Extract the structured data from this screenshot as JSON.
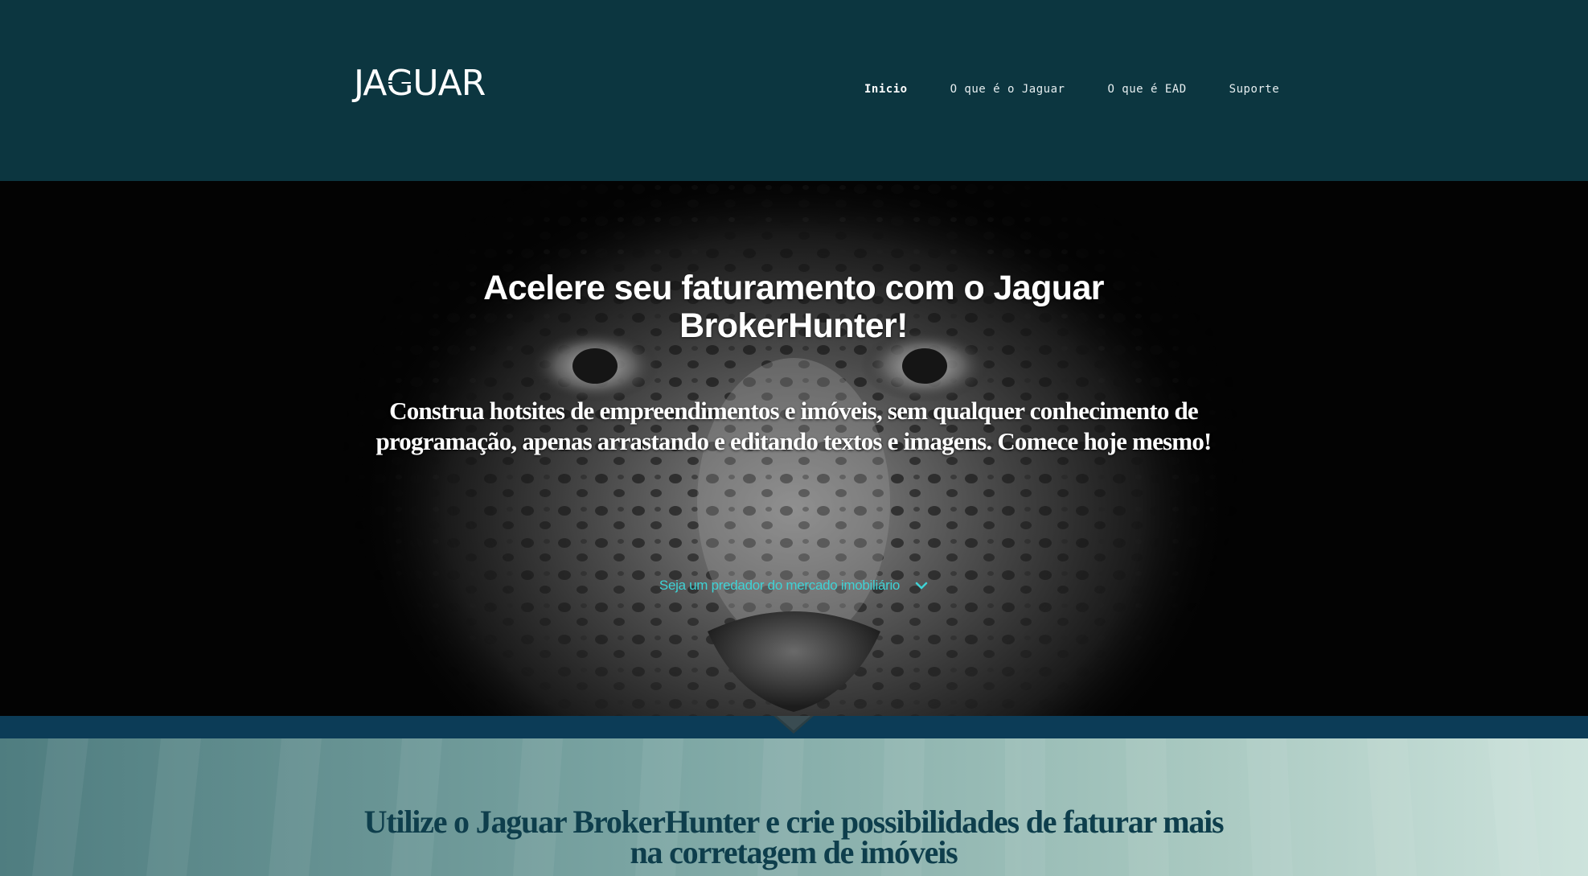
{
  "header": {
    "logo_text_left": "JA",
    "logo_text_g": "G",
    "logo_text_right": "UAR",
    "nav": [
      {
        "label": "Inicio",
        "active": true
      },
      {
        "label": "O que é o Jaguar",
        "active": false
      },
      {
        "label": "O que é EAD",
        "active": false
      },
      {
        "label": "Suporte",
        "active": false
      }
    ]
  },
  "hero": {
    "title_line1": "Acelere seu faturamento com o Jaguar",
    "title_line2": "BrokerHunter!",
    "subtitle": "Construa hotsites de empreendimentos e imóveis, sem qualquer conhecimento de programação, apenas arrastando e editando textos e imagens. Comece hoje mesmo!",
    "cta_label": "Seja um predador do mercado imobiliário",
    "cta_icon": "chevron-down-icon",
    "background_image": "jaguar-face-photo"
  },
  "section2": {
    "title": "Utilize o Jaguar BrokerHunter e crie possibilidades de faturar mais na corretagem de imóveis"
  },
  "colors": {
    "header_bg": "#0c3640",
    "band_bg": "#0c3c57",
    "cta": "#3fd3d6",
    "section2_title": "#0e3e4c"
  }
}
